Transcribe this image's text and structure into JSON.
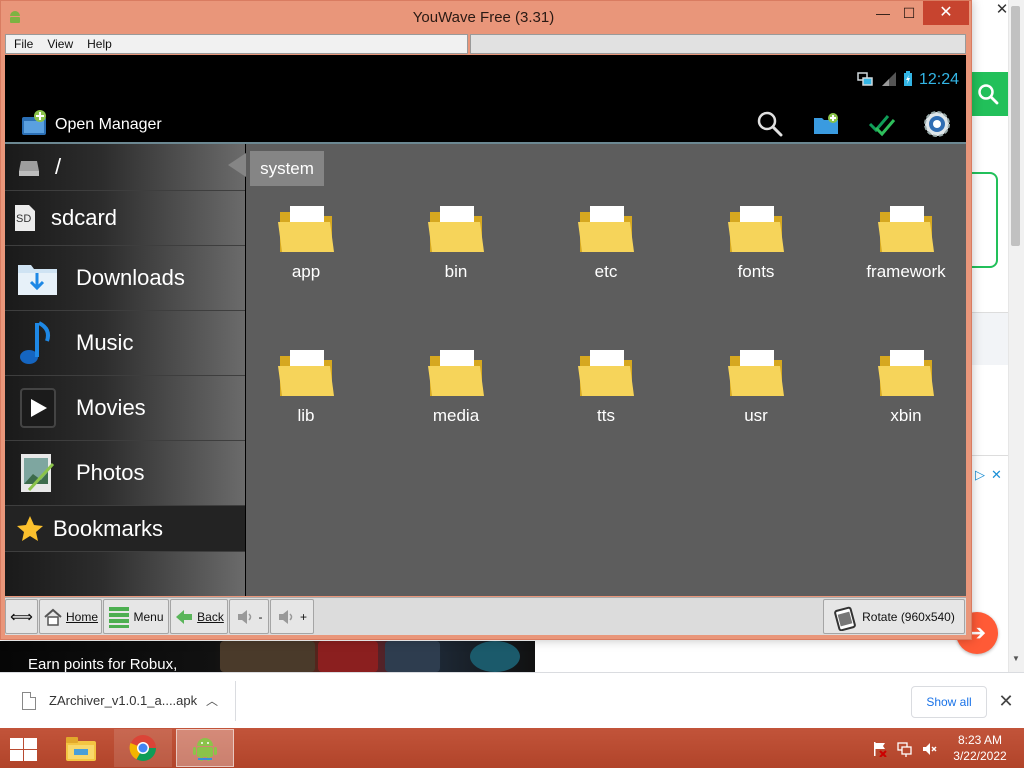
{
  "window": {
    "title": "YouWave Free (3.31)",
    "minimize": "—",
    "maximize": "☐",
    "close": "✕"
  },
  "menu": [
    "File",
    "View",
    "Help"
  ],
  "android": {
    "status_time": "12:24",
    "app_title": "Open Manager",
    "actions": [
      "search-icon",
      "new-folder-icon",
      "multi-select-icon",
      "settings-gear-icon"
    ],
    "breadcrumb": "system",
    "sidebar": {
      "root": "/",
      "sdcard_badge": "SD",
      "sdcard": "sdcard",
      "downloads": "Downloads",
      "music": "Music",
      "movies": "Movies",
      "photos": "Photos",
      "bookmarks": "Bookmarks"
    },
    "folders": [
      "app",
      "bin",
      "etc",
      "fonts",
      "framework",
      "lib",
      "media",
      "tts",
      "usr",
      "xbin"
    ]
  },
  "toolbar": {
    "resize_glyph": "⟺",
    "home": "Home",
    "menu": "Menu",
    "back": "Back",
    "vol_down": "-",
    "vol_up": "+",
    "rotate": "Rotate (960x540)"
  },
  "browser": {
    "ad_text": "Earn points for Robux,",
    "bg_close": "✕",
    "fab_arrow": "➔",
    "ad_choices": [
      "▷",
      "✕"
    ],
    "scroll_down": "▼"
  },
  "download_bar": {
    "filename": "ZArchiver_v1.0.1_a....apk",
    "chevron": "︿",
    "show_all": "Show all",
    "close": "✕"
  },
  "taskbar": {
    "time": "8:23 AM",
    "date": "3/22/2022",
    "tray_icons": [
      "flag-icon",
      "network-icon",
      "speaker-muted-icon"
    ]
  },
  "colors": {
    "window_frame": "#e9967a",
    "holo_blue": "#33b5e5",
    "taskbar": "#b84a30",
    "brand_green": "#22c05a"
  }
}
